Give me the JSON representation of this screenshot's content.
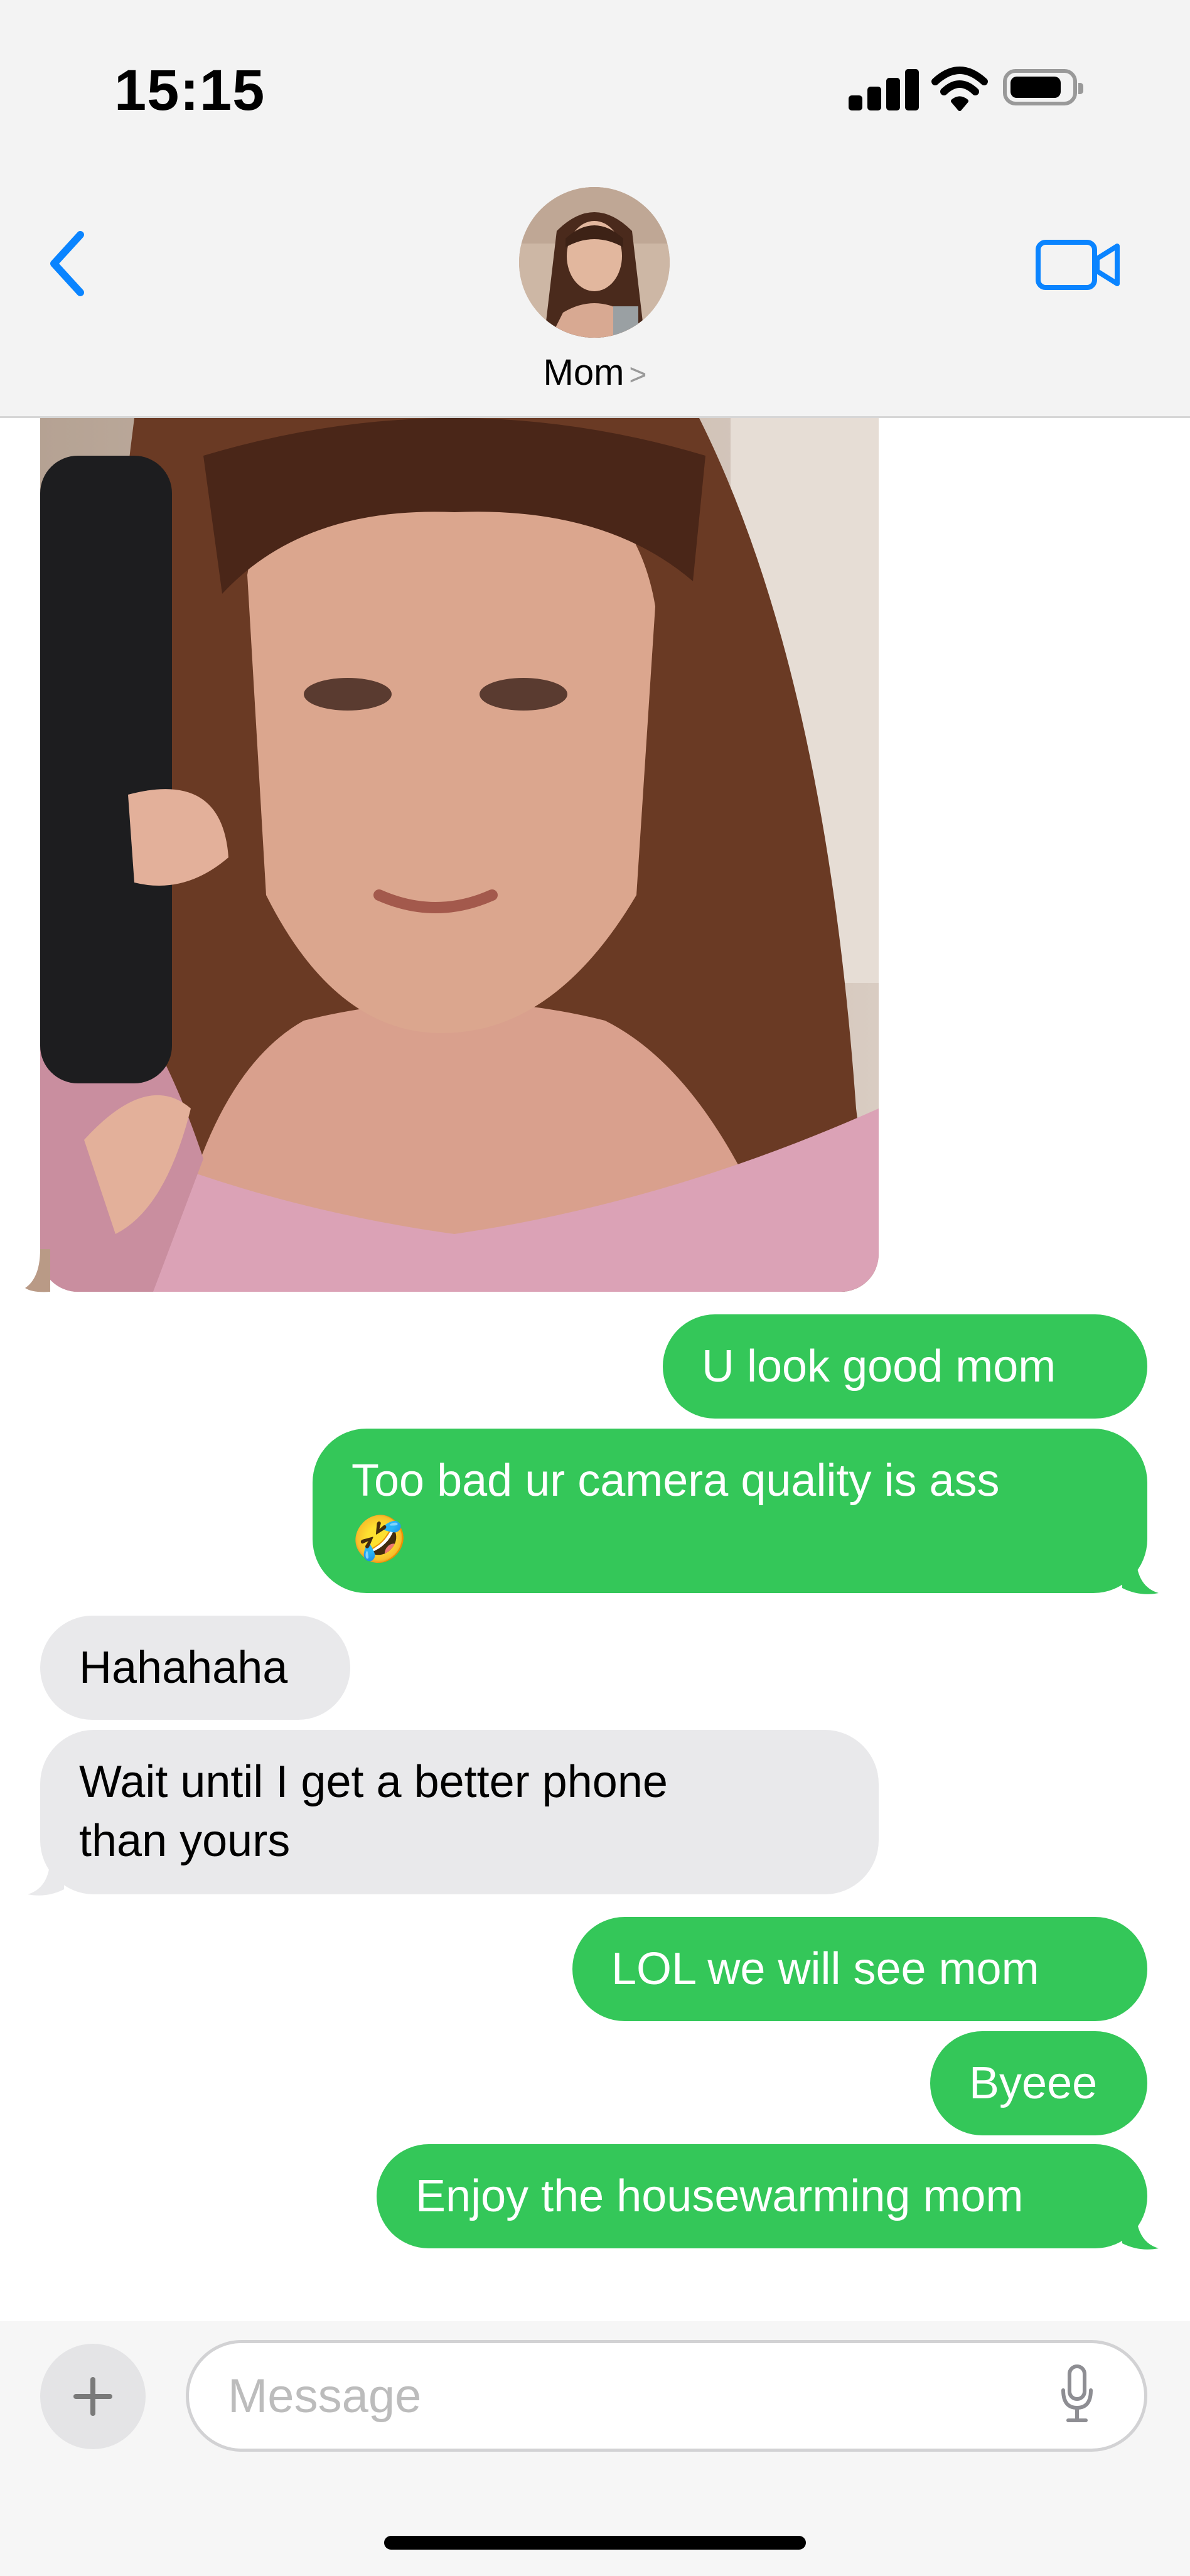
{
  "status_bar": {
    "time": "15:15",
    "icons": [
      "cellular-signal-icon",
      "wifi-icon",
      "battery-icon"
    ]
  },
  "header": {
    "contact_name": "Mom",
    "chevron": ">",
    "icons": {
      "back": "chevron-left-icon",
      "video": "facetime-video-icon"
    }
  },
  "messages": [
    {
      "id": "m0",
      "direction": "incoming",
      "type": "image",
      "content": "photo-attachment"
    },
    {
      "id": "m1",
      "direction": "outgoing",
      "text": "U look good mom"
    },
    {
      "id": "m2",
      "direction": "outgoing",
      "text": "Too bad ur camera quality is ass\n🤣"
    },
    {
      "id": "m3",
      "direction": "incoming",
      "text": "Hahahaha"
    },
    {
      "id": "m4",
      "direction": "incoming",
      "text": "Wait until I get a better phone\nthan yours"
    },
    {
      "id": "m5",
      "direction": "outgoing",
      "text": "LOL we will see mom"
    },
    {
      "id": "m6",
      "direction": "outgoing",
      "text": "Byeee"
    },
    {
      "id": "m7",
      "direction": "outgoing",
      "text": "Enjoy the housewarming mom"
    }
  ],
  "composer": {
    "placeholder": "Message",
    "icons": {
      "add": "plus-icon",
      "mic": "microphone-icon"
    }
  },
  "colors": {
    "outgoing": "#34c759",
    "incoming": "#e9e9eb",
    "accent": "#0a84ff"
  }
}
